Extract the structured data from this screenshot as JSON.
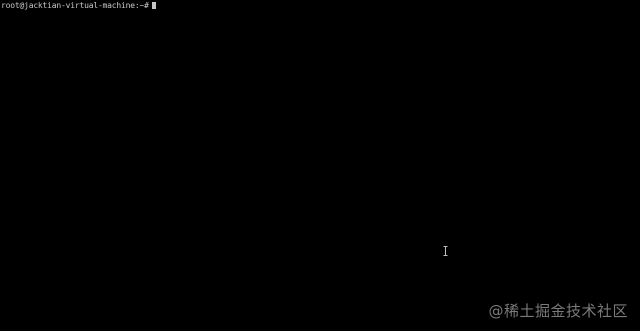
{
  "terminal": {
    "prompt": "root@jacktian-virtual-machine:~#",
    "cursor_visible": true,
    "text_color": "#c8c8c8",
    "background_color": "#000000"
  },
  "mouse": {
    "icon": "text-cursor-icon"
  },
  "watermark": {
    "text": "@稀土掘金技术社区",
    "color": "#7a7a7a"
  }
}
